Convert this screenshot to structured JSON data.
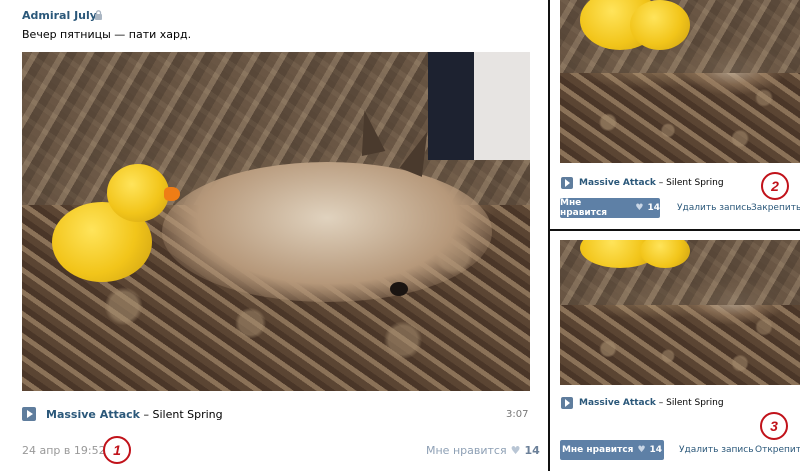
{
  "post": {
    "author": "Admiral July",
    "text": "Вечер пятницы — пати хард.",
    "audio": {
      "artist": "Massive Attack",
      "separator": " – ",
      "title": "Silent Spring",
      "duration": "3:07"
    },
    "date": "24 апр в 19:52",
    "like_label": "Мне нравится",
    "like_count": "14"
  },
  "markers": [
    "1",
    "2",
    "3"
  ],
  "panel_top": {
    "audio": {
      "artist": "Massive Attack",
      "separator": " – ",
      "title": "Silent Spring"
    },
    "like_label": "Мне нравится",
    "like_count": "14",
    "delete_label": "Удалить запись",
    "pin_label": "Закрепить"
  },
  "panel_bottom": {
    "audio": {
      "artist": "Massive Attack",
      "separator": " – ",
      "title": "Silent Spring"
    },
    "like_label": "Мне нравится",
    "like_count": "14",
    "delete_label": "Удалить запись",
    "unpin_label": "Открепить"
  },
  "colors": {
    "link": "#2b587a",
    "like_button": "#5e80a6",
    "marker": "#c1121a"
  }
}
